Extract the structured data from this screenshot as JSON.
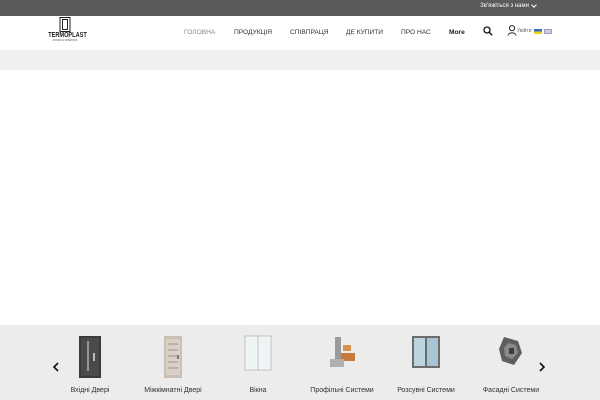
{
  "topbar": {
    "contact_label": "Зв'яжіться з нами"
  },
  "logo": {
    "brand": "TERMOPLAST",
    "tagline": "DOORS & WINDOWS"
  },
  "nav": {
    "items": [
      {
        "label": "ГОЛОВНА"
      },
      {
        "label": "ПРОДУКЦІЯ"
      },
      {
        "label": "СПІВПРАЦЯ"
      },
      {
        "label": "ДЕ КУПИТИ"
      },
      {
        "label": "ПРО НАС"
      },
      {
        "label": "More"
      }
    ]
  },
  "header_actions": {
    "user_label": "Увійти"
  },
  "carousel": {
    "products": [
      {
        "label": "Вхідні Двері"
      },
      {
        "label": "Міжкімнатні Двері"
      },
      {
        "label": "Вікна"
      },
      {
        "label": "Профільні Системи"
      },
      {
        "label": "Розсувні Системи"
      },
      {
        "label": "Фасадні Системи"
      }
    ]
  },
  "colors": {
    "topbar": "#5a5a5a",
    "carousel_bg": "#ececec",
    "strip": "#efefef"
  }
}
